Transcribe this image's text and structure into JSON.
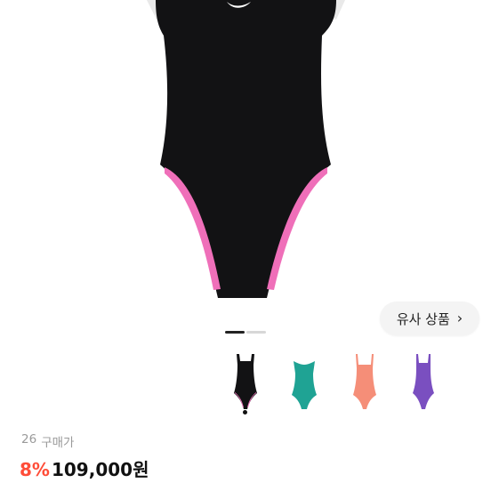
{
  "product": {
    "similar_button_label": "유사 상품",
    "similar_button_chevron": "›",
    "purchase_count": "26",
    "purchase_label": "구매가",
    "discount": "8%",
    "price": "109,000원"
  },
  "colors": {
    "swimsuit_body": "#121214",
    "swimsuit_lining": "#ef6fb9",
    "accent_discount": "#ff4d38",
    "thumbnail_colors": [
      "#121214",
      "#1fa394",
      "#f58e78",
      "#7a4fc0"
    ]
  },
  "thumbnails": [
    {
      "name": "black-pink",
      "selected": true
    },
    {
      "name": "teal",
      "selected": false
    },
    {
      "name": "coral",
      "selected": false
    },
    {
      "name": "purple",
      "selected": false
    }
  ]
}
